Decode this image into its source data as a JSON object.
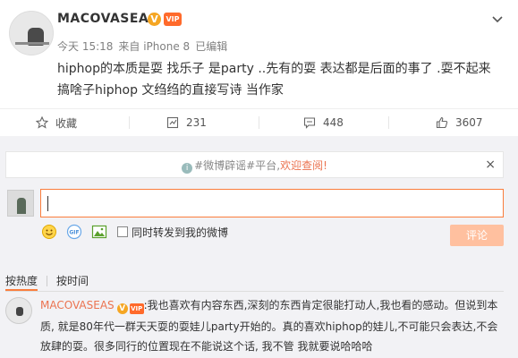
{
  "post": {
    "username": "MACOVASEAS",
    "verified_badge": "V",
    "vip_badge": "VIP",
    "time": "今天 15:18",
    "source": "来自 iPhone 8",
    "edited": "已编辑",
    "content": "hiphop的本质是耍 找乐子 是party ..先有的耍 表达都是后面的事了 .耍不起来 搞啥子hiphop 文绉绉的直接写诗 当作家"
  },
  "actions": {
    "favorite_label": "收藏",
    "repost_count": "231",
    "comment_count": "448",
    "like_count": "3607"
  },
  "notice": {
    "text_lead": "#微博辟谣#平台,",
    "text_link": "欢迎查阅!",
    "close": "×"
  },
  "compose": {
    "repost_checkbox_label": "同时转发到我的微博",
    "submit_label": "评论"
  },
  "sort": {
    "tab_hot": "按热度",
    "tab_time": "按时间"
  },
  "comment": {
    "username": "MACOVASEAS",
    "text": ":我也喜欢有内容东西,深刻的东西肯定很能打动人,我也看的感动。但说到本质, 就是80年代一群天天耍的耍娃儿party开始的。真的喜欢hiphop的娃儿,不可能只会表达,不会放肆的耍。很多同行的位置现在不能说这个话, 我不管 我就要说哈哈哈"
  },
  "colors": {
    "accent": "#fa7d3c",
    "link": "#eb7350",
    "submit_disabled": "#ffc09f"
  }
}
